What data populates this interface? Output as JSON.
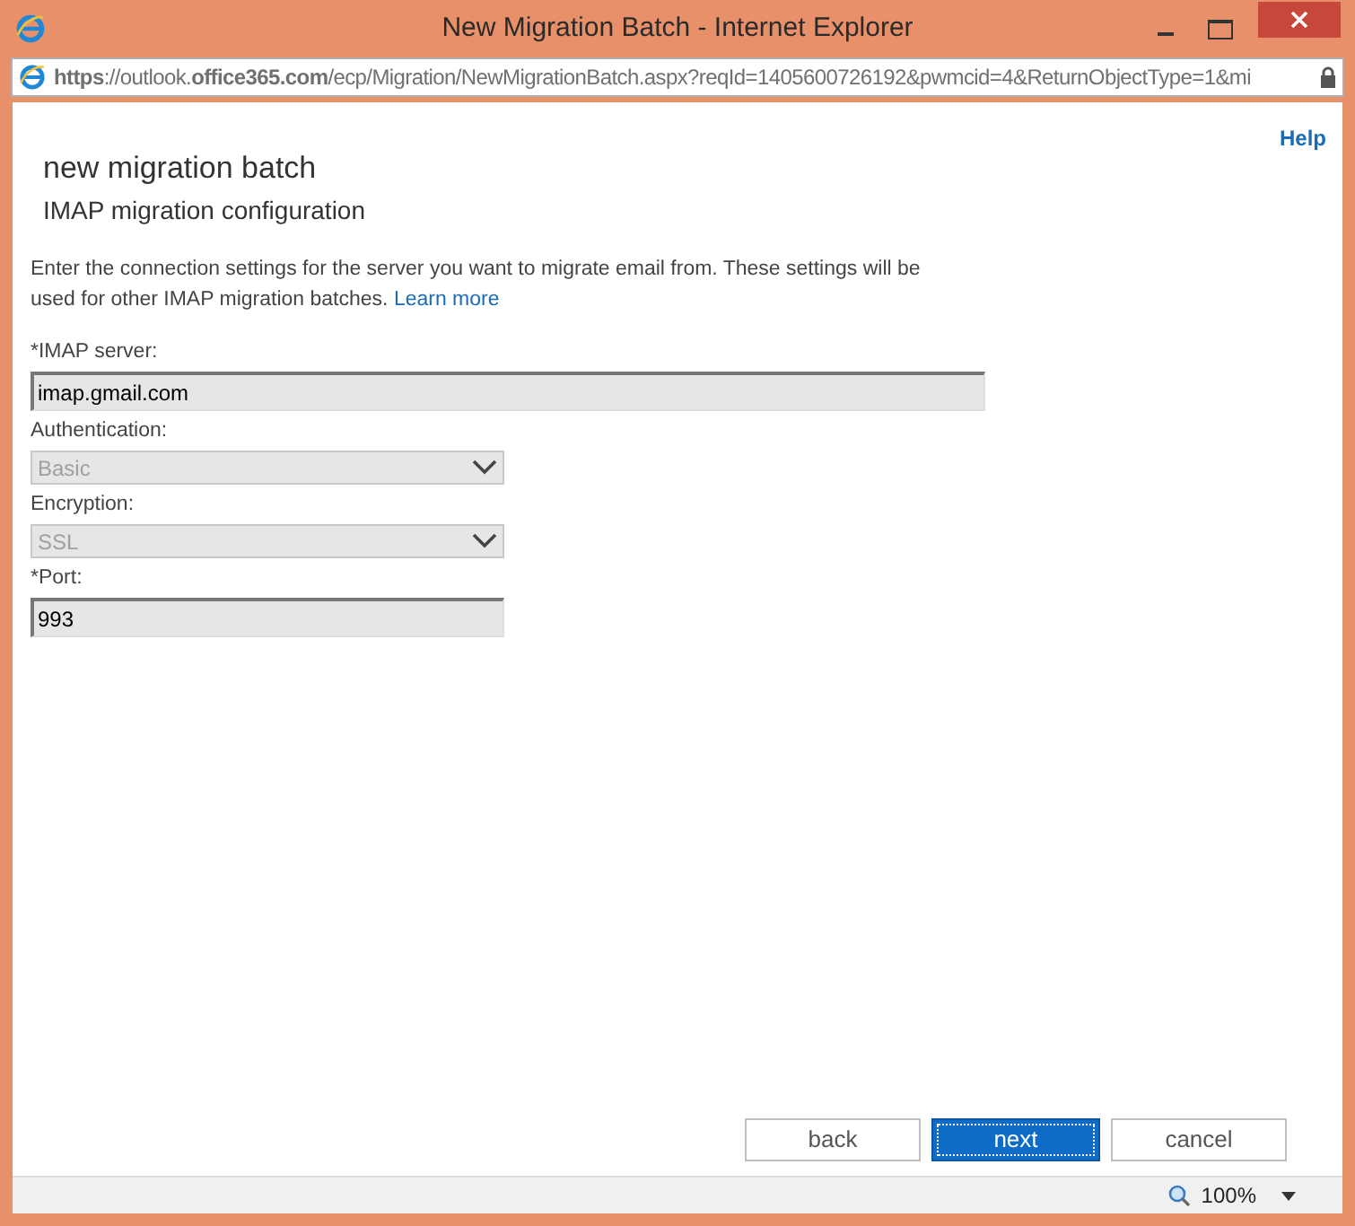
{
  "window": {
    "title": "New Migration Batch - Internet Explorer"
  },
  "address_bar": {
    "url": "**https**://outlook.**office365.com**/ecp/Migration/NewMigrationBatch.aspx?reqId=1405600726192&pwmcid=4&ReturnObjectType=1&mi"
  },
  "help_link": "Help",
  "heading": "new migration batch",
  "subheading": "IMAP migration configuration",
  "description": "Enter the connection settings for the server you want to migrate email from. These settings will be used for other IMAP migration batches.",
  "learn_more_link": "Learn more",
  "fields": [
    {
      "kind": "text",
      "label": "*IMAP server:",
      "value": "imap.gmail.com",
      "disabled": false,
      "wide": true
    },
    {
      "kind": "select",
      "label": "Authentication:",
      "value": "Basic",
      "disabled": true,
      "wide": false
    },
    {
      "kind": "select",
      "label": "Encryption:",
      "value": "SSL",
      "disabled": true,
      "wide": false
    },
    {
      "kind": "text",
      "label": "*Port:",
      "value": "993",
      "disabled": false,
      "wide": false
    }
  ],
  "buttons": [
    {
      "label": "back",
      "primary": false
    },
    {
      "label": "next",
      "primary": true
    },
    {
      "label": "cancel",
      "primary": false
    }
  ],
  "status_bar": {
    "zoom": "100%"
  }
}
